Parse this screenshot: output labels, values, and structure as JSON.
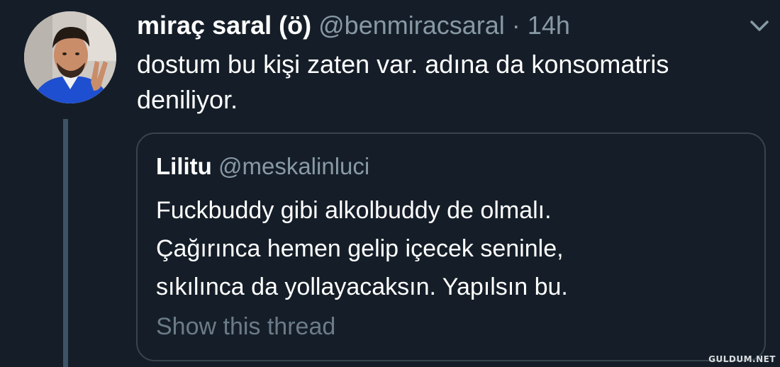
{
  "tweet": {
    "display_name": "miraç saral (ö)",
    "handle": "@benmiracsaral",
    "separator": "·",
    "time": "14h",
    "text": "dostum bu kişi zaten var. adına da konsomatris deniliyor.",
    "avatar_icon": "profile-photo",
    "menu_icon": "chevron-down-icon"
  },
  "quote": {
    "display_name": "Lilitu",
    "handle": "@meskalinluci",
    "lines": [
      "Fuckbuddy gibi alkolbuddy de olmalı.",
      "Çağırınca hemen gelip içecek seninle,",
      "sıkılınca da yollayacaksın. Yapılsın bu."
    ],
    "show_thread": "Show this thread"
  },
  "watermark": "GULDUM.NET",
  "colors": {
    "background": "#151e28",
    "text_primary": "#ffffff",
    "text_secondary": "#8899a6",
    "border": "#38444d",
    "thread_line": "#3d5466"
  }
}
